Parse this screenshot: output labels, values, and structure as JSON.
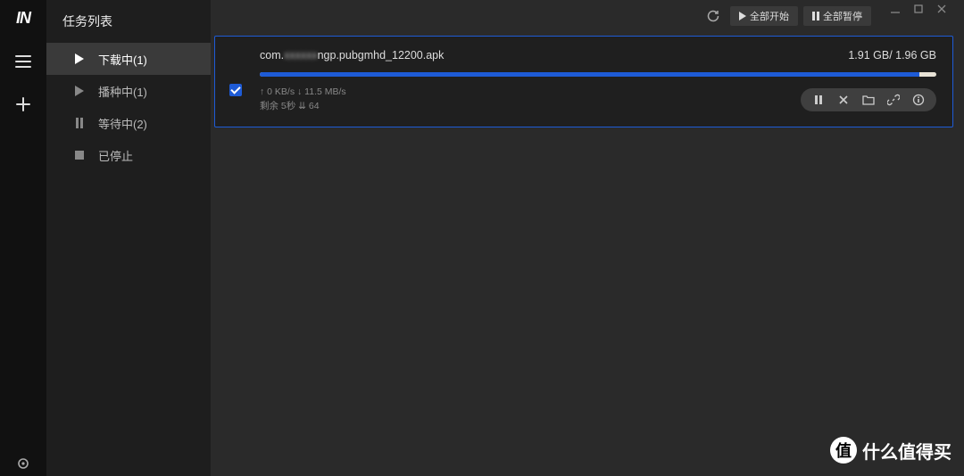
{
  "sidebar": {
    "title": "任务列表",
    "items": [
      {
        "label": "下载中(1)"
      },
      {
        "label": "播种中(1)"
      },
      {
        "label": "等待中(2)"
      },
      {
        "label": "已停止"
      }
    ]
  },
  "topbar": {
    "start_all": "全部开始",
    "pause_all": "全部暂停"
  },
  "task": {
    "filename_prefix": "com.",
    "filename_blur": "xxxxxx",
    "filename_suffix": "ngp.pubgmhd_12200.apk",
    "size": "1.91 GB/ 1.96 GB",
    "progress_pct": 97.5,
    "speed_line": "↑ 0 KB/s  ↓ 11.5 MB/s",
    "eta_line": "剩余 5秒  ⇊ 64"
  },
  "watermark": {
    "badge": "值",
    "text": "什么值得买"
  }
}
